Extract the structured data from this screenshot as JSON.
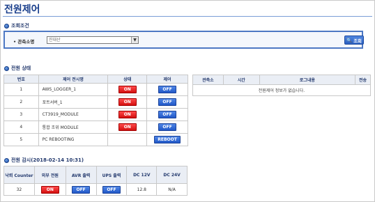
{
  "page_title": "전원제어",
  "search": {
    "section_title": "조회조건",
    "label": "관측소명",
    "selected_value": "진대산",
    "button_label": "조회"
  },
  "power_status": {
    "section_title": "전원 상태",
    "headers": [
      "번호",
      "제어 전시명",
      "상태",
      "제어"
    ],
    "rows": [
      {
        "no": "1",
        "name": "AWS_LOGGER_1",
        "state": "ON",
        "control": "OFF"
      },
      {
        "no": "2",
        "name": "포트서버_1",
        "state": "ON",
        "control": "OFF"
      },
      {
        "no": "3",
        "name": "CT3919_MODULE",
        "state": "ON",
        "control": "OFF"
      },
      {
        "no": "4",
        "name": "통합 조위 MODULE",
        "state": "ON",
        "control": "OFF"
      },
      {
        "no": "5",
        "name": "PC REBOOTING",
        "state": "",
        "control": "REBOOT"
      }
    ]
  },
  "log": {
    "headers": [
      "관측소",
      "시간",
      "로그내용",
      "전송"
    ],
    "empty_message": "전원제어 정보가 없습니다."
  },
  "monitor": {
    "section_title": "전원 감시(2018-02-14 10:31)",
    "headers": [
      "낙뢰 Counter",
      "외부 전원",
      "AVR 출력",
      "UPS 출력",
      "DC 12V",
      "DC 24V"
    ],
    "values": {
      "counter": "32",
      "external": "ON",
      "avr": "OFF",
      "ups": "OFF",
      "dc12": "12.8",
      "dc24": "N/A"
    }
  }
}
